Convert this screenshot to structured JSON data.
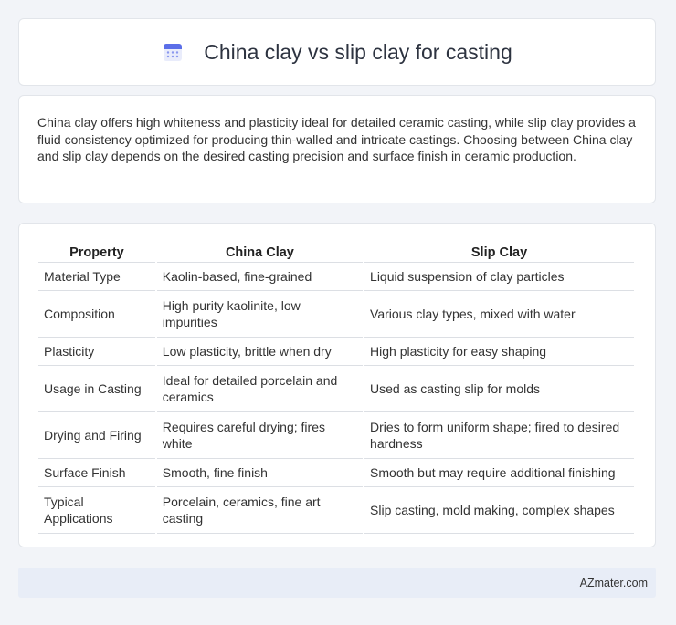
{
  "header": {
    "title": "China clay vs slip clay for casting",
    "icon": "calendar-icon"
  },
  "summary": {
    "text": "China clay offers high whiteness and plasticity ideal for detailed ceramic casting, while slip clay provides a fluid consistency optimized for producing thin-walled and intricate castings. Choosing between China clay and slip clay depends on the desired casting precision and surface finish in ceramic production."
  },
  "table": {
    "headers": [
      "Property",
      "China Clay",
      "Slip Clay"
    ],
    "rows": [
      [
        "Material Type",
        "Kaolin-based, fine-grained",
        "Liquid suspension of clay particles"
      ],
      [
        "Composition",
        "High purity kaolinite, low impurities",
        "Various clay types, mixed with water"
      ],
      [
        "Plasticity",
        "Low plasticity, brittle when dry",
        "High plasticity for easy shaping"
      ],
      [
        "Usage in Casting",
        "Ideal for detailed porcelain and ceramics",
        "Used as casting slip for molds"
      ],
      [
        "Drying and Firing",
        "Requires careful drying; fires white",
        "Dries to form uniform shape; fired to desired hardness"
      ],
      [
        "Surface Finish",
        "Smooth, fine finish",
        "Smooth but may require additional finishing"
      ],
      [
        "Typical Applications",
        "Porcelain, ceramics, fine art casting",
        "Slip casting, mold making, complex shapes"
      ]
    ]
  },
  "footer": {
    "brand": "AZmater.com"
  },
  "colors": {
    "accent": "#5b6ee8",
    "background": "#f2f4f8",
    "footer_bg": "#e8edf7"
  }
}
